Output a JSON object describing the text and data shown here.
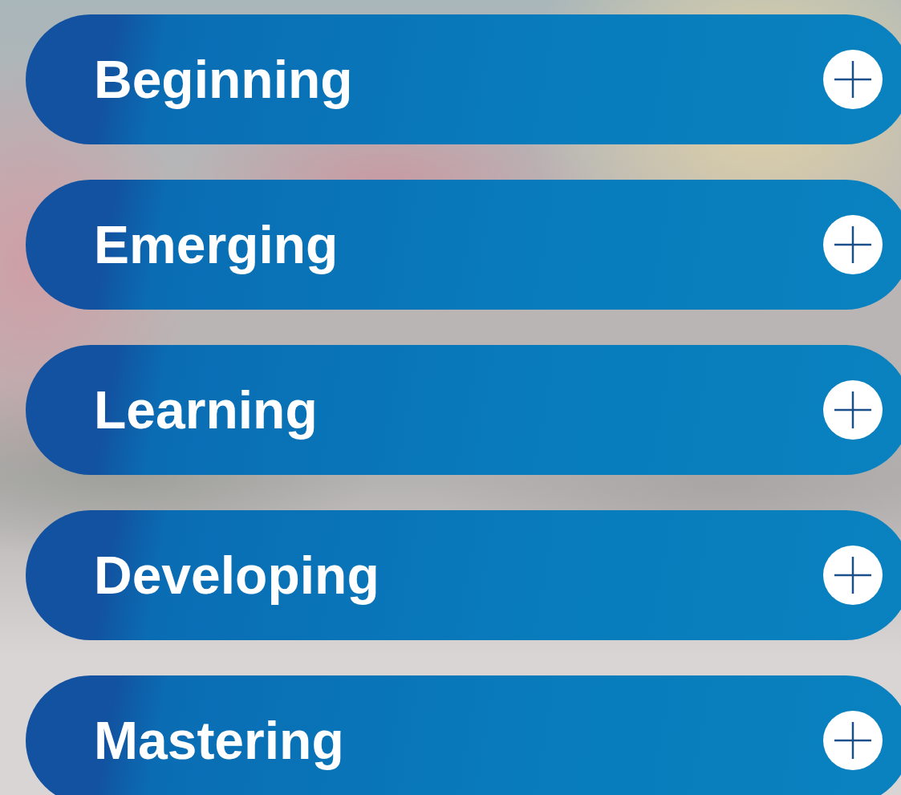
{
  "sections": [
    {
      "label": "Beginning",
      "expanded": false
    },
    {
      "label": "Emerging",
      "expanded": false
    },
    {
      "label": "Learning",
      "expanded": false
    },
    {
      "label": "Developing",
      "expanded": false
    },
    {
      "label": "Mastering",
      "expanded": false
    }
  ]
}
